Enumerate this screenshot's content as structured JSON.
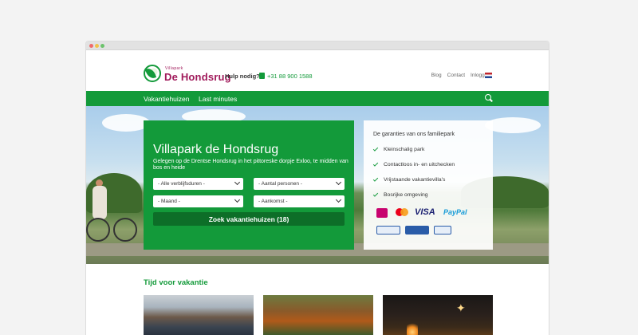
{
  "header": {
    "logo_small": "Villapark",
    "logo_big": "De Hondsrug",
    "help_label": "Hulp nodig?",
    "phone": "+31 88 900 1588",
    "links": [
      "Blog",
      "Contact",
      "Inloggen"
    ]
  },
  "nav": {
    "items": [
      "Vakantiehuizen",
      "Last minutes"
    ]
  },
  "search": {
    "title": "Villapark de Hondsrug",
    "subtitle": "Gelegen op de Drentse Hondsrug in het pittoreske dorpje Exloo, te midden van bos en heide",
    "selects": [
      "- Alle verblijfsduren -",
      "- Aantal personen -",
      "- Maand -",
      "- Aankomst -"
    ],
    "button": "Zoek vakantiehuizen (18)"
  },
  "guarantees": {
    "title": "De garanties van ons familiepark",
    "items": [
      "Kleinschalig park",
      "Contactloos in- en uitchecken",
      "Vrijstaande vakantievilla's",
      "Bosrijke omgeving"
    ],
    "payment": {
      "visa": "VISA",
      "paypal": "PayPal"
    }
  },
  "section": {
    "title": "Tijd voor vakantie"
  },
  "colors": {
    "brand_green": "#139a3a",
    "logo_magenta": "#a0195a"
  }
}
